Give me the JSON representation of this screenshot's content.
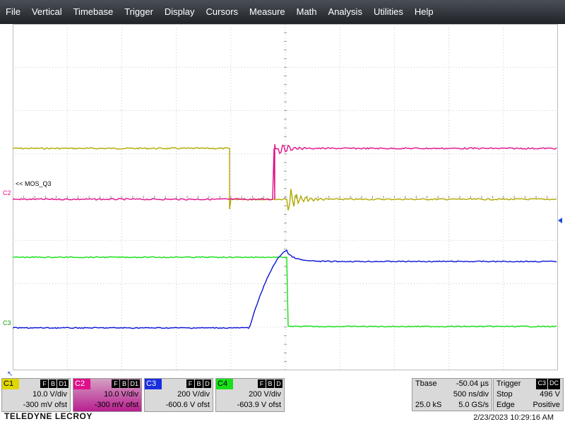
{
  "menu": [
    "File",
    "Vertical",
    "Timebase",
    "Trigger",
    "Display",
    "Cursors",
    "Measure",
    "Math",
    "Analysis",
    "Utilities",
    "Help"
  ],
  "colors": {
    "c1": "#b0a800",
    "c2": "#e0108a",
    "c3": "#0a14d8",
    "c4": "#10e010",
    "grid": "#c8c8c8"
  },
  "trace_label": "<< MOS_Q3",
  "markers": {
    "c2": "C2",
    "c3": "C3"
  },
  "channels": [
    {
      "name": "C1",
      "flags": [
        "F",
        "B",
        "D1"
      ],
      "vdiv": "10.0 V/div",
      "ofst": "-300 mV ofst"
    },
    {
      "name": "C2",
      "flags": [
        "F",
        "B",
        "D1"
      ],
      "vdiv": "10.0 V/div",
      "ofst": "-300 mV ofst"
    },
    {
      "name": "C3",
      "flags": [
        "F",
        "B",
        "D"
      ],
      "vdiv": "200 V/div",
      "ofst": "-600.6 V ofst"
    },
    {
      "name": "C4",
      "flags": [
        "F",
        "B",
        "D"
      ],
      "vdiv": "200 V/div",
      "ofst": "-603.9 V ofst"
    }
  ],
  "timebase": {
    "label": "Tbase",
    "delay": "-50.04 µs",
    "tdiv": "500 ns/div",
    "samples": "25.0 kS",
    "rate": "5.0 GS/s"
  },
  "trigger": {
    "label": "Trigger",
    "src": "C3",
    "coupling": "DC",
    "mode": "Stop",
    "level": "496 V",
    "type": "Edge",
    "slope": "Positive"
  },
  "brand": "TELEDYNE LECROY",
  "timestamp": "2/23/2023 10:29:16 AM"
}
